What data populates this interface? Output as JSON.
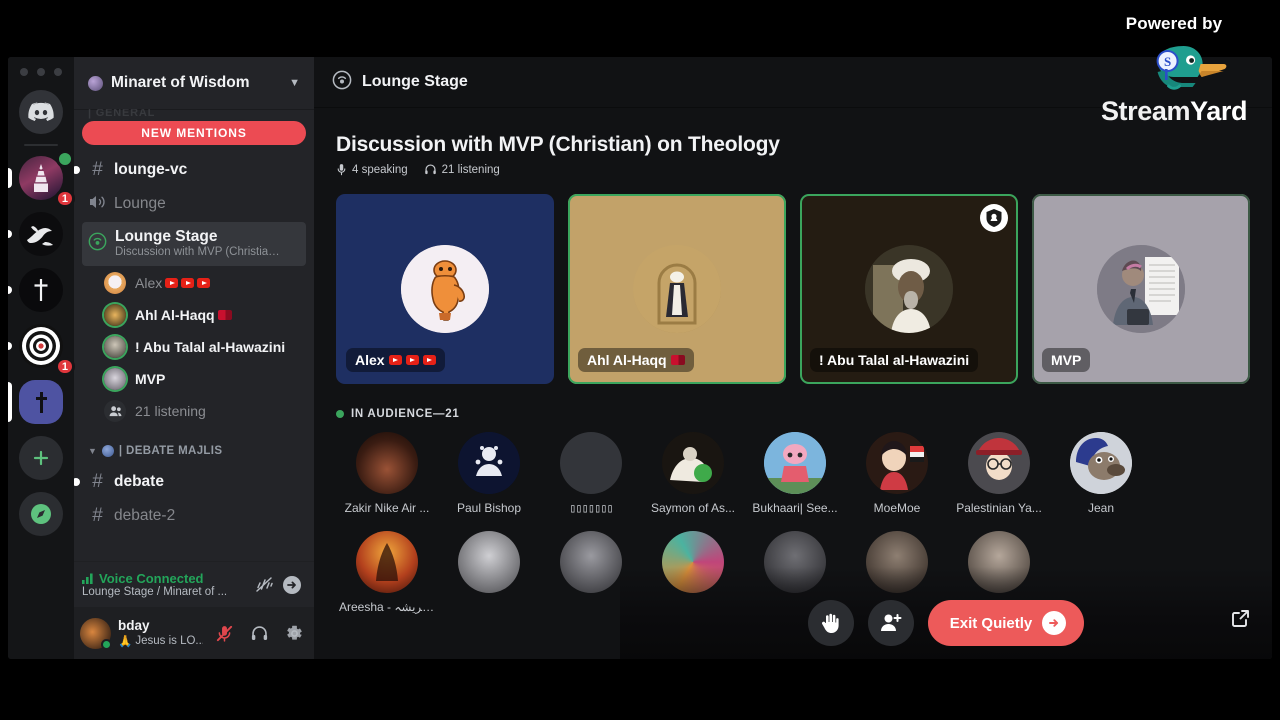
{
  "branding": {
    "powered_by": "Powered by",
    "logo_stream": "Stream",
    "logo_yard": "Yard",
    "duck_badge_letter": "S",
    "duck_color": "#1f9e8f",
    "bill_color": "#e8a33d",
    "badge_color": "#2b4ec9"
  },
  "rail": {
    "items": [
      {
        "name": "home-discord",
        "badge": "",
        "indicator": "none"
      },
      {
        "name": "server-minaret",
        "badge": "1",
        "status_dot": true,
        "indicator": "half"
      },
      {
        "name": "server-art",
        "badge": "",
        "indicator": "dot"
      },
      {
        "name": "server-cross",
        "badge": "",
        "indicator": "dot"
      },
      {
        "name": "server-target",
        "badge": "1",
        "indicator": "dot"
      },
      {
        "name": "server-selected-cross",
        "badge": "",
        "indicator": "full"
      },
      {
        "name": "add-server",
        "badge": "",
        "indicator": "none"
      },
      {
        "name": "explore-servers",
        "badge": "",
        "indicator": "none"
      }
    ]
  },
  "sidebar": {
    "guild_name": "Minaret of Wisdom",
    "mentions_button": "NEW MENTIONS",
    "ghost_category": "| GENERAL",
    "channels": [
      {
        "type": "text",
        "name": "lounge-vc",
        "state": "active",
        "unread": true
      },
      {
        "type": "voice",
        "name": "Lounge",
        "state": "muted",
        "unread": false
      }
    ],
    "stage": {
      "name": "Lounge Stage",
      "topic": "Discussion with MVP (Christian) ..."
    },
    "speakers": [
      {
        "name": "Alex",
        "emojis": [
          "youtube",
          "youtube",
          "youtube"
        ],
        "style": "dim",
        "speaking": false
      },
      {
        "name": "Ahl Al-Haqq",
        "emojis": [
          "flag"
        ],
        "style": "bold",
        "speaking": true
      },
      {
        "name": "! Abu Talal al-Hawazini",
        "emojis": [],
        "style": "bold",
        "speaking": true
      },
      {
        "name": "MVP",
        "emojis": [],
        "style": "bold",
        "speaking": true
      }
    ],
    "listening_label": "21 listening",
    "category": {
      "label": "| DEBATE MAJLIS"
    },
    "category_channels": [
      {
        "type": "text",
        "name": "debate",
        "state": "active",
        "unread": true
      },
      {
        "type": "text",
        "name": "debate-2",
        "state": "muted",
        "unread": false
      }
    ],
    "voice_panel": {
      "status": "Voice Connected",
      "location": "Lounge Stage / Minaret of ...",
      "icons": [
        "noise-suppression-icon",
        "disconnect-icon"
      ]
    },
    "user_panel": {
      "username": "bday",
      "status_text": "Jesus is LO...",
      "status_emoji": "🙏",
      "icons": [
        "mic-muted-icon",
        "headphones-icon",
        "settings-gear-icon"
      ]
    }
  },
  "main": {
    "header_title": "Lounge Stage",
    "discussion_title": "Discussion with MVP (Christian) on Theology",
    "speaking_count": "4 speaking",
    "listening_count": "21 listening",
    "tiles": [
      {
        "name": "Alex",
        "emojis": [
          "youtube",
          "youtube",
          "youtube"
        ],
        "bg": "#1e2f62",
        "speaking": false,
        "moderator": false
      },
      {
        "name": "Ahl Al-Haqq",
        "emojis": [
          "flag"
        ],
        "bg": "#c2a269",
        "speaking": true,
        "moderator": false
      },
      {
        "name": "! Abu Talal al-Hawazini",
        "emojis": [],
        "bg": "#241c12",
        "speaking": true,
        "moderator": true
      },
      {
        "name": "MVP",
        "emojis": [],
        "bg": "#a6a2ab",
        "speaking": false,
        "moderator": false
      }
    ],
    "audience_label": "IN AUDIENCE—21",
    "audience": [
      {
        "name": "Zakir Nike Air ...",
        "tofu": false,
        "av": "dark-warm"
      },
      {
        "name": "Paul Bishop",
        "tofu": false,
        "av": "navy-crest"
      },
      {
        "name": "▯▯▯▯▯▯▯",
        "tofu": true,
        "av": "plain-grey"
      },
      {
        "name": "Saymon of As...",
        "tofu": false,
        "av": "white-green"
      },
      {
        "name": "Bukhaari| See...",
        "tofu": false,
        "av": "anime-blue"
      },
      {
        "name": "MoeMoe",
        "tofu": false,
        "av": "anime-red"
      },
      {
        "name": "Palestinian Ya...",
        "tofu": false,
        "av": "anime-hat"
      },
      {
        "name": "Jean",
        "tofu": false,
        "av": "dog-blue"
      },
      {
        "name": "Areesha - ـریشہ...",
        "tofu": false,
        "av": "sunset"
      }
    ],
    "audience_row2": [
      {
        "name": "",
        "av": "row2-a"
      },
      {
        "name": "",
        "av": "row2-b"
      },
      {
        "name": "",
        "av": "row2-c"
      },
      {
        "name": "",
        "av": "row2-d"
      },
      {
        "name": "",
        "av": "row2-e"
      },
      {
        "name": "",
        "av": "row2-f"
      }
    ],
    "controls": {
      "raise_hand": "raise-hand-icon",
      "invite": "invite-person-icon",
      "exit_label": "Exit Quietly",
      "popout": "popout-icon"
    }
  },
  "colors": {
    "accent_red": "#ed5a5a",
    "mentions_red": "#ec4b53",
    "speaking_green": "#3ba55d",
    "online_green": "#23a55a",
    "sidebar_bg": "#232428",
    "main_bg": "#111214",
    "rail_bg": "#141517"
  }
}
